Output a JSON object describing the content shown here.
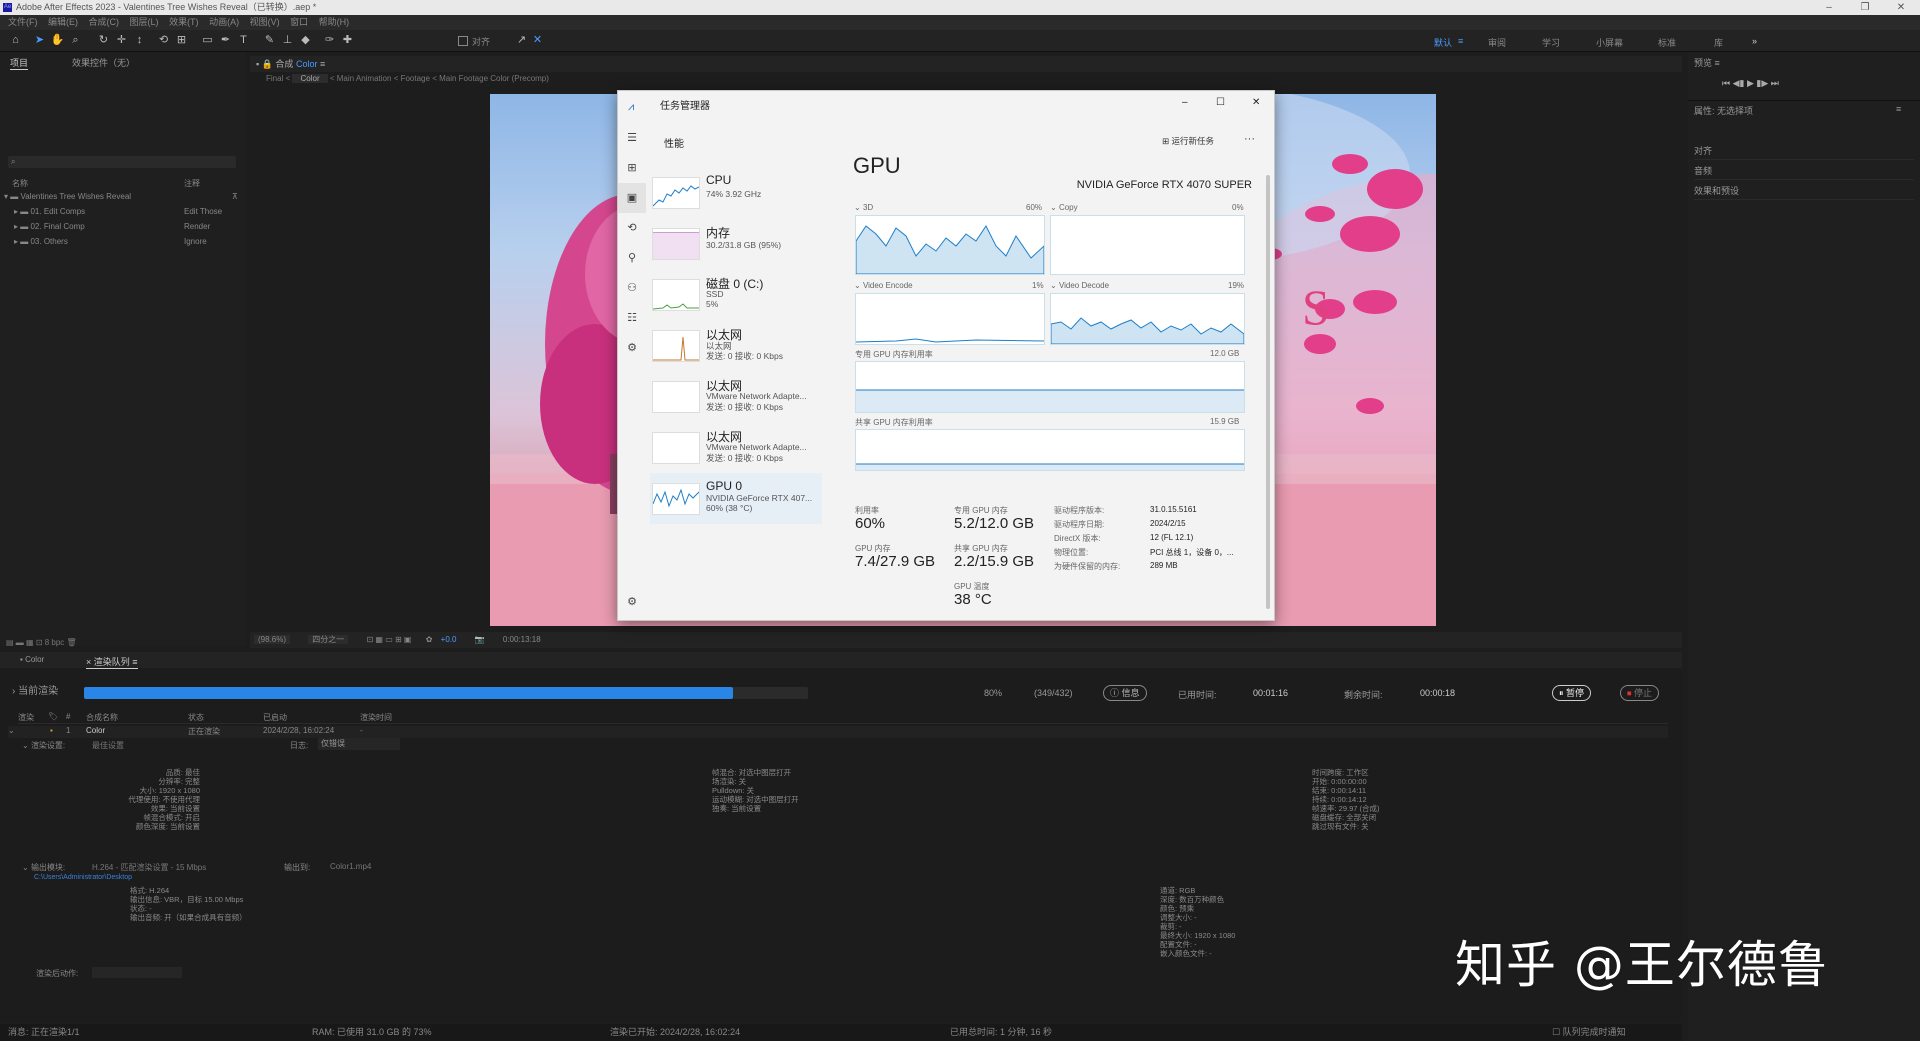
{
  "window": {
    "title": "Adobe After Effects 2023 - Valentines Tree Wishes Reveal（已转换）.aep *",
    "app_icon": "Ae"
  },
  "menu": [
    "文件(F)",
    "编辑(E)",
    "合成(C)",
    "图层(L)",
    "效果(T)",
    "动画(A)",
    "视图(V)",
    "窗口",
    "帮助(H)"
  ],
  "toolbar": {
    "align_label": "对齐",
    "workspaces": [
      "默认",
      "审阅",
      "学习",
      "小屏幕",
      "标准",
      "库"
    ]
  },
  "project_panel": {
    "tab_project": "项目",
    "tab_effects": "效果控件（无）",
    "search_icon": "search-icon",
    "col_name": "名称",
    "col_comment": "注释",
    "items": [
      {
        "name": "Valentines Tree Wishes Reveal",
        "comment": ""
      },
      {
        "name": "01. Edit Comps",
        "comment": "Edit Those"
      },
      {
        "name": "02. Final Comp",
        "comment": "Render"
      },
      {
        "name": "03. Others",
        "comment": "Ignore"
      }
    ],
    "bpc": "8 bpc"
  },
  "comp_panel": {
    "tab_prefix": "合成",
    "tab_name": "Color",
    "breadcrumbs": [
      "Final",
      "Color",
      "Main Animation",
      "Footage",
      "Main Footage Color (Precomp)"
    ],
    "zoom": "(98.6%)",
    "resolution": "四分之一",
    "exposure": "+0.0",
    "timecode": "0:00:13:18"
  },
  "task_manager": {
    "title": "任务管理器",
    "section": "性能",
    "run_task": "运行新任务",
    "more": "···",
    "sidebar_items": [
      "hamburger-icon",
      "processes-icon",
      "performance-icon",
      "history-icon",
      "startup-icon",
      "users-icon",
      "details-icon",
      "services-icon",
      "settings-icon"
    ],
    "items": [
      {
        "name": "CPU",
        "line1": "74%  3.92 GHz",
        "line2": "",
        "line3": ""
      },
      {
        "name": "内存",
        "line1": "30.2/31.8 GB (95%)",
        "line2": "",
        "line3": ""
      },
      {
        "name": "磁盘 0 (C:)",
        "line1": "SSD",
        "line2": "5%",
        "line3": ""
      },
      {
        "name": "以太网",
        "line1": "以太网",
        "line2": "发送: 0 接收: 0 Kbps",
        "line3": ""
      },
      {
        "name": "以太网",
        "line1": "VMware Network Adapte...",
        "line2": "发送: 0 接收: 0 Kbps",
        "line3": ""
      },
      {
        "name": "以太网",
        "line1": "VMware Network Adapte...",
        "line2": "发送: 0 接收: 0 Kbps",
        "line3": ""
      },
      {
        "name": "GPU 0",
        "line1": "NVIDIA GeForce RTX 407...",
        "line2": "60% (38 °C)",
        "line3": ""
      }
    ],
    "gpu": {
      "heading": "GPU",
      "model": "NVIDIA GeForce RTX 4070 SUPER",
      "graph1_label": "3D",
      "graph1_pct": "60%",
      "graph2_label": "Copy",
      "graph2_pct": "0%",
      "graph3_label": "Video Encode",
      "graph3_pct": "1%",
      "graph4_label": "Video Decode",
      "graph4_pct": "19%",
      "dedicated_label": "专用 GPU 内存利用率",
      "dedicated_max": "12.0 GB",
      "shared_label": "共享 GPU 内存利用率",
      "shared_max": "15.9 GB",
      "util_label": "利用率",
      "util": "60%",
      "ded_mem_label": "专用 GPU 内存",
      "ded_mem": "5.2/12.0 GB",
      "gpu_mem_label": "GPU 内存",
      "gpu_mem": "7.4/27.9 GB",
      "sh_mem_label": "共享 GPU 内存",
      "sh_mem": "2.2/15.9 GB",
      "temp_label": "GPU 温度",
      "temp": "38 °C",
      "driver_ver_label": "驱动程序版本:",
      "driver_ver": "31.0.15.5161",
      "driver_date_label": "驱动程序日期:",
      "driver_date": "2024/2/15",
      "directx_label": "DirectX 版本:",
      "directx": "12 (FL 12.1)",
      "location_label": "物理位置:",
      "location": "PCI 总线 1，设备 0，...",
      "reserved_label": "为硬件保留的内存:",
      "reserved": "289 MB"
    }
  },
  "render_queue": {
    "tab_color": "Color",
    "tab_queue": "渲染队列",
    "current_render": "当前渲染",
    "progress_pct": 80,
    "progress_text": "80%",
    "frames": "(349/432)",
    "info_btn": "信息",
    "elapsed_label": "已用时间:",
    "elapsed": "00:01:16",
    "remaining_label": "剩余时间:",
    "remaining": "00:00:18",
    "pause_btn": "暂停",
    "stop_btn": "停止",
    "columns": [
      "渲染",
      "标签",
      "#",
      "合成名称",
      "状态",
      "已启动",
      "渲染时间"
    ],
    "row": {
      "num": "1",
      "name": "Color",
      "status": "正在渲染",
      "started": "2024/2/28, 16:02:24",
      "time": "-"
    },
    "render_settings_label": "渲染设置:",
    "render_settings_value": "最佳设置",
    "log_label": "日志:",
    "log_value": "仅错误",
    "col1": [
      "品质: 最佳",
      "分辨率: 完整",
      "大小: 1920 x 1080",
      "代理使用: 不使用代理",
      "效果: 当前设置",
      "帧混合模式: 开启",
      "颜色深度: 当前设置"
    ],
    "col2": [
      "帧混合: 对选中图层打开",
      "场渲染: 关",
      "Pulldown: 关",
      "运动模糊: 对选中图层打开",
      "",
      "独奏: 当前设置"
    ],
    "col3": [
      "时间跨度: 工作区",
      "开始: 0:00:00:00",
      "结束: 0:00:14:11",
      "持续: 0:00:14:12",
      "帧速率: 29.97 (合成)",
      "磁盘缓存: 全部关闭",
      "",
      "跳过现有文件: 关"
    ],
    "output_module_label": "输出模块:",
    "output_module_value": "H.264 - 匹配渲染设置 - 15 Mbps",
    "output_to_label": "输出到:",
    "output_to_value": "Color1.mp4",
    "output_path": "C:\\Users\\Administrator\\Desktop",
    "out_col1": [
      "格式: H.264",
      "输出信息: VBR，目标 15.00 Mbps",
      "",
      "",
      "",
      "状态: -",
      "输出音频: 开（如果合成具有音频）"
    ],
    "out_col3": [
      "通道: RGB",
      "深度: 数百万种颜色",
      "颜色: 预乘",
      "调整大小: -",
      "裁剪: -",
      "最终大小: 1920 x 1080",
      "配置文件: -",
      "嵌入颜色文件: -"
    ],
    "post_render_label": "渲染后动作:"
  },
  "status_bar": {
    "message": "消息: 正在渲染1/1",
    "ram": "RAM: 已使用 31.0 GB 的 73%",
    "started": "渲染已开始: 2024/2/28, 16:02:24",
    "total_time": "已用总时间: 1 分钟, 16 秒",
    "notify": "队列完成时通知"
  },
  "right_panel": {
    "preview_tab": "预览",
    "properties_tab": "属性: 无选择项",
    "items": [
      "对齐",
      "音频",
      "效果和预设"
    ]
  },
  "watermark": "知乎 @王尔德鲁"
}
